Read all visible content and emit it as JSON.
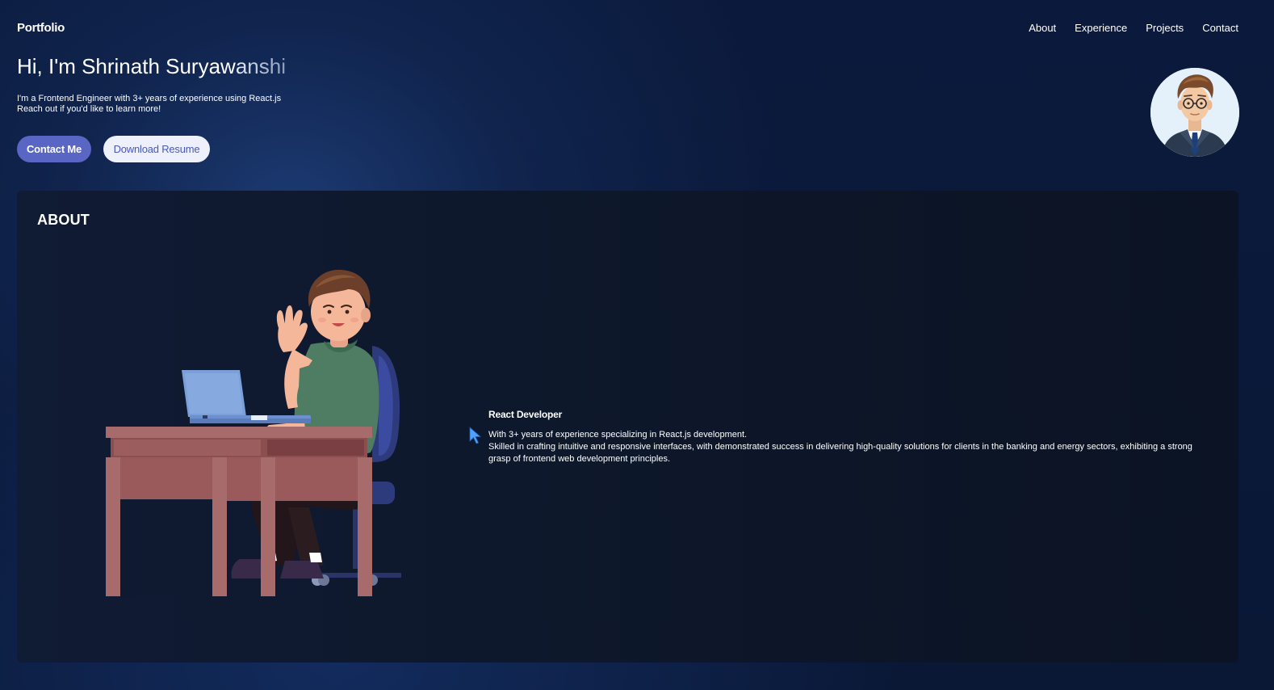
{
  "nav": {
    "brand": "Portfolio",
    "links": [
      "About",
      "Experience",
      "Projects",
      "Contact"
    ]
  },
  "hero": {
    "headline_main": "Hi, I'm Shrinath Suryaw",
    "headline_fade": "anshi",
    "intro_line1": "I'm a Frontend Engineer with 3+ years of experience using React.js",
    "intro_line2": "Reach out if you'd like to learn more!",
    "contact_label": "Contact Me",
    "resume_label": "Download Resume"
  },
  "about": {
    "title": "ABOUT",
    "role": "React Developer",
    "desc_line1": "With 3+ years of experience specializing in React.js development.",
    "desc_line2": "Skilled in crafting intuitive and responsive interfaces, with demonstrated success in delivering high-quality solutions for clients in the banking and energy sectors, exhibiting a strong grasp of frontend web development principles."
  },
  "colors": {
    "primary_button": "#5966c4",
    "secondary_button": "#eef1fb",
    "card_background": "#0d1729",
    "page_background": "#0a1836"
  },
  "icons": [
    "avatar-portrait",
    "developer-at-desk-illustration",
    "mouse-cursor-icon"
  ]
}
